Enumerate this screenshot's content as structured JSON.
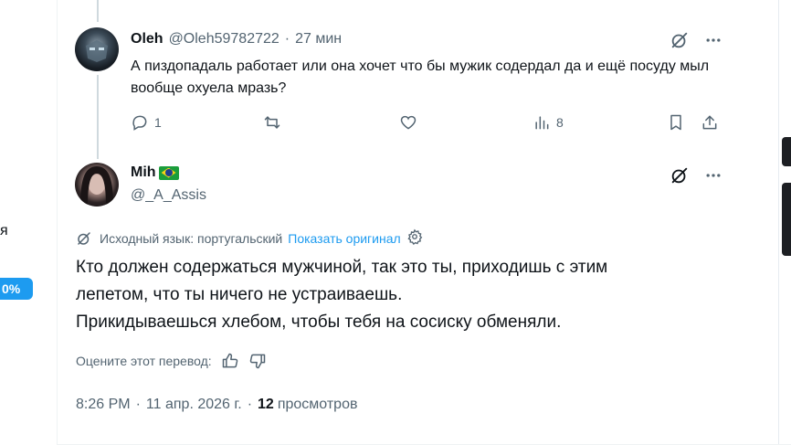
{
  "left_fragment": {
    "text": "я",
    "badge": "0%"
  },
  "reply": {
    "author_name": "Oleh",
    "handle": "@Oleh59782722",
    "time": "27 мин",
    "text": "А пиздопадаль работает или она хочет что бы мужик содердал да и ещё посуду мыл вообще охуела мразь?",
    "reply_count": "1",
    "views_count": "8"
  },
  "focal": {
    "author_name": "Mih",
    "handle": "@_A_Assis",
    "source_lang_label": "Исходный язык: португальский",
    "show_original": "Показать оригинал",
    "text_lines": [
      "Кто должен содержаться мужчиной, так это ты, приходишь с этим",
      "лепетом, что ты ничего не устраиваешь.",
      "Прикидываешься хлебом, чтобы тебя на сосиску обменяли."
    ],
    "rate_label": "Оцените этот перевод:",
    "time": "8:26 PM",
    "date": "11 апр. 2026 г.",
    "views_count": "12",
    "views_label": "просмотров"
  },
  "colors": {
    "accent": "#1d9bf0",
    "text": "#0f1419",
    "muted": "#536471"
  }
}
